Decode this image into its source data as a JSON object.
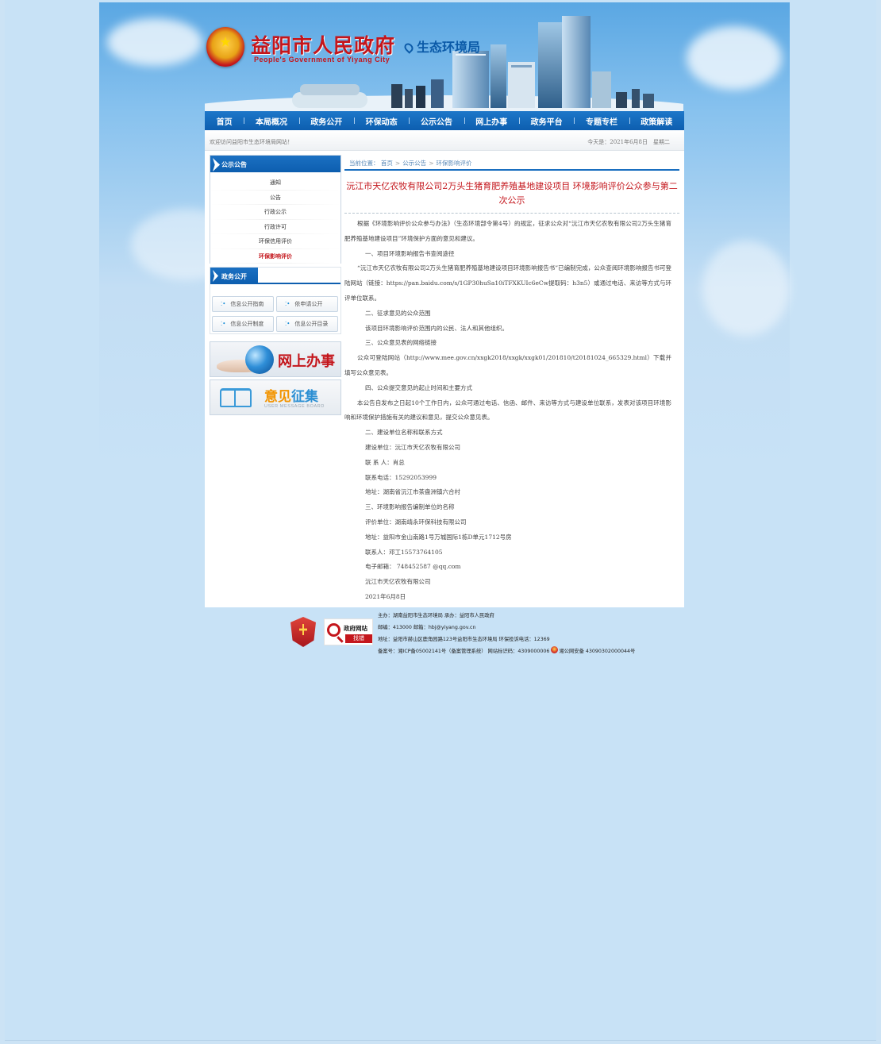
{
  "header": {
    "title": "益阳市人民政府",
    "subtitle": "People's Government of Yiyang City",
    "bureau": "生态环境局"
  },
  "nav": {
    "items": [
      "首页",
      "本局概况",
      "政务公开",
      "环保动态",
      "公示公告",
      "网上办事",
      "政务平台",
      "专题专栏",
      "政策解读"
    ]
  },
  "welcome": {
    "text": "欢迎访问益阳市生态环境局网站！",
    "date": "今天是：2021年6月8日　星期二"
  },
  "sidebar": {
    "section_title": "公示公告",
    "items": [
      {
        "label": "通知",
        "active": false
      },
      {
        "label": "公告",
        "active": false
      },
      {
        "label": "行政公示",
        "active": false
      },
      {
        "label": "行政许可",
        "active": false
      },
      {
        "label": "环保信用评价",
        "active": false
      },
      {
        "label": "环保影响评价",
        "active": true
      }
    ],
    "gov_title": "政务公开",
    "gov_buttons": [
      "信息公开指南",
      "依申请公开",
      "信息公开制度",
      "信息公开目录"
    ],
    "online_service": "网上办事",
    "opinion_title_a": "意见",
    "opinion_title_b": "征集",
    "opinion_sub": "USER MESSAGE BOARD"
  },
  "breadcrumb": {
    "label": "当前位置：",
    "items": [
      "首页",
      "公示公告",
      "环保影响评价"
    ]
  },
  "article": {
    "title": "沅江市天亿农牧有限公司2万头生猪育肥养殖基地建设项目 环境影响评价公众参与第二次公示",
    "paragraphs": [
      "根据《环境影响评价公众参与办法》（生态环境部令第4号）的规定，征求公众对“沅江市天亿农牧有限公司2万头生猪育肥养殖基地建设项目”环境保护方面的意见和建议。",
      "一、项目环境影响报告书查阅途径",
      "“沅江市天亿农牧有限公司2万头生猪育肥养殖基地建设项目环境影响报告书”已编制完成，公众查阅环境影响报告书可登陆网站（链接：https://pan.baidu.com/s/1GP30huSa10iTFXKUIc6eCw提取码：h3n5）或通过电话、来访等方式与环评单位联系。",
      "二、征求意见的公众范围",
      "该项目环境影响评价范围内的公民、法人和其他组织。",
      "三、公众意见表的网络链接",
      "公众可登陆网站（http://www.mee.gov.cn/xxgk2018/xxgk/xxgk01/201810/t20181024_665329.html）下载并填写公众意见表。",
      "四、公众提交意见的起止时间和主要方式",
      "本公告自发布之日起10个工作日内，公众可通过电话、信函、邮件、来访等方式与建设单位联系，发表对该项目环境影响和环境保护措施有关的建议和意见，提交公众意见表。",
      "二、建设单位名称和联系方式",
      "建设单位：沅江市天亿农牧有限公司",
      "联 系 人：肖总",
      "联系电话：15292053999",
      "地址：湖南省沅江市茶盘洲镇六合村",
      "三、环境影响报告编制单位的名称",
      "评价单位：湖南靖永环保科技有限公司",
      "地址：益阳市金山南路1号万城国际1栋D单元1712号房",
      "联系人：邓工15573764105",
      "电子邮箱： 748452587 @qq.com",
      "沅江市天亿农牧有限公司",
      "2021年6月8日"
    ]
  },
  "footer": {
    "badge_label": "党政机关",
    "gov_find_top": "政府网站",
    "gov_find_bottom": "找错",
    "line1": "主办：湖南益阳市生态环境局 承办：益阳市人民政府",
    "line2": "邮编：413000 邮箱：hbj@yiyang.gov.cn",
    "line3": "地址：益阳市赫山区鹿角园路123号益阳市生态环境局 环保投诉电话：12369",
    "line4_a": "备案号：湘ICP备05002141号（备案管理系统） 网站标识码：4309000006",
    "line4_b": "湘公网安备 43090302000044号"
  },
  "colors": {
    "brand_red": "#c4161c",
    "nav_blue": "#0d5eaf",
    "page_bg": "#cce3f5"
  }
}
